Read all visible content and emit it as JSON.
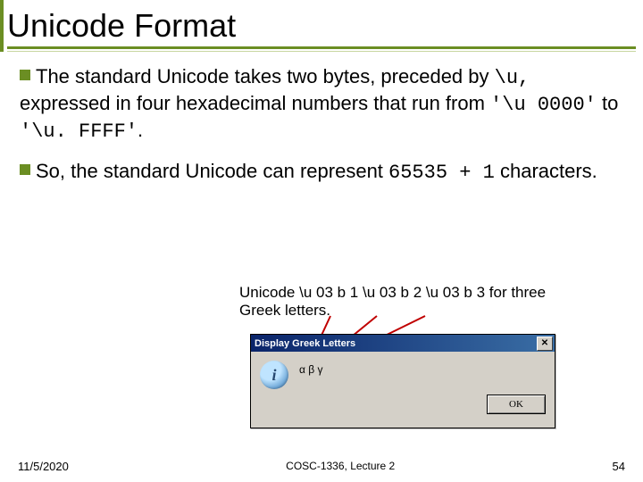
{
  "title": "Unicode Format",
  "bullets": [
    {
      "pre": "The standard Unicode takes two bytes, preceded by ",
      "code1": "\\u,",
      "mid": " expressed in four hexadecimal numbers that run from ",
      "code2": "'\\u 0000'",
      "mid2": " to ",
      "code3": "'\\u. FFFF'",
      "post": "."
    },
    {
      "pre": "So, the standard Unicode can represent ",
      "code1": "65535 + 1",
      "post": " characters."
    }
  ],
  "caption": "Unicode \\u 03 b 1 \\u 03 b 2 \\u 03 b 3 for three Greek letters.",
  "dialog": {
    "title": "Display Greek Letters",
    "message": "α β γ",
    "ok": "OK",
    "icon_letter": "i"
  },
  "footer": {
    "left": "11/5/2020",
    "center": "COSC-1336, Lecture 2",
    "right": "54"
  }
}
